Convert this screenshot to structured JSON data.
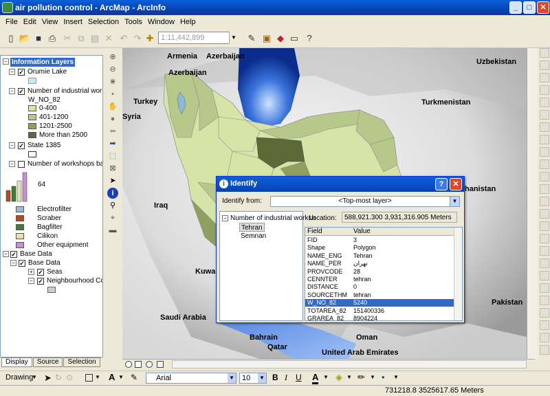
{
  "window": {
    "title": "air pollution control - ArcMap - ArcInfo",
    "min": "_",
    "max": "□",
    "close": "✕"
  },
  "menu": [
    "File",
    "Edit",
    "View",
    "Insert",
    "Selection",
    "Tools",
    "Window",
    "Help"
  ],
  "toolbar": {
    "scale": "1:11,442,899"
  },
  "toc": {
    "root": "Information Layers",
    "lake": "Orumie Lake",
    "workshops_layer": "Number of industrial worksho",
    "field": "W_NO_82",
    "classes": [
      {
        "label": "0-400",
        "color": "#d7e4a7"
      },
      {
        "label": "401-1200",
        "color": "#b7c98a"
      },
      {
        "label": "1201-2500",
        "color": "#8e9f60"
      },
      {
        "label": "More than 2500",
        "color": "#5b6a36"
      }
    ],
    "state": "State 1385",
    "workshops_based": "Number of workshops basec",
    "chart_value": "64",
    "equipment": [
      {
        "label": "Electrofilter",
        "color": "#9dbbd5"
      },
      {
        "label": "Scraber",
        "color": "#b54a22"
      },
      {
        "label": "Bagfilter",
        "color": "#3f7d31"
      },
      {
        "label": "Cilikon",
        "color": "#e6e2b4"
      },
      {
        "label": "Other equipment",
        "color": "#c78fd3"
      }
    ],
    "base_group": "Base Data",
    "base_sub": "Base Data",
    "seas": "Seas",
    "neighbour": "Neighbourhood Cou",
    "tabs": [
      "Display",
      "Source",
      "Selection"
    ]
  },
  "map_labels": {
    "armenia": "Armenia",
    "azerbaijan1": "Azerbaijan",
    "azerbaijan2": "Azerbaijan",
    "uzbekistan": "Uzbekistan",
    "turkey": "Turkey",
    "syria": "Syria",
    "turkmenistan": "Turkmenistan",
    "iraq": "Iraq",
    "afghanistan": "hanistan",
    "kuwait": "Kuwai",
    "pakistan": "Pakistan",
    "saudi": "Saudi Arabia",
    "bahrain": "Bahrain",
    "qatar": "Qatar",
    "oman": "Oman",
    "uae": "United Arab Emirates"
  },
  "identify": {
    "title": "Identify",
    "help": "?",
    "close": "✕",
    "from_label": "Identify from:",
    "from_value": "<Top-most layer>",
    "tree_root": "Number of industrial worksh",
    "tree_items": [
      "Tehran",
      "Semnan"
    ],
    "location_label": "Location:",
    "location_value": "588,921.300  3,931,316.905 Meters",
    "col_field": "Field",
    "col_value": "Value",
    "rows": [
      {
        "field": "FID",
        "value": "3"
      },
      {
        "field": "Shape",
        "value": "Polygon"
      },
      {
        "field": "NAME_ENG",
        "value": "Tehran"
      },
      {
        "field": "NAME_PER",
        "value": "تهران"
      },
      {
        "field": "PROVCODE",
        "value": "28"
      },
      {
        "field": "CENNTER",
        "value": "tehran"
      },
      {
        "field": "DISTANCE",
        "value": "0"
      },
      {
        "field": "SOURCETHM",
        "value": "tehran"
      },
      {
        "field": "W_NO_82",
        "value": "5240"
      },
      {
        "field": "TOTAREA_82",
        "value": "151400336"
      },
      {
        "field": "GRAREA_82",
        "value": "8904224"
      }
    ],
    "selected_row": 8
  },
  "drawbar": {
    "drawing": "Drawing",
    "font": "Arial",
    "size": "10",
    "bold": "B",
    "italic": "I",
    "underline": "U"
  },
  "status": {
    "coords": "731218.8  3525617.65 Meters"
  }
}
